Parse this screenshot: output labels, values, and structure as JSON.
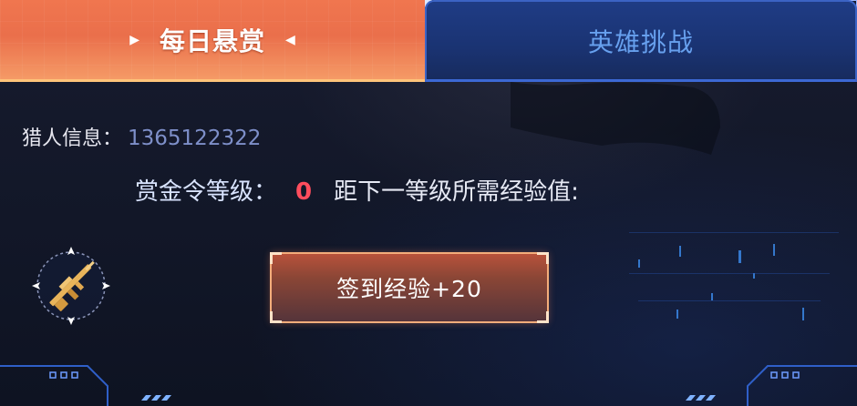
{
  "tabs": [
    {
      "label": "每日悬赏",
      "active": true
    },
    {
      "label": "英雄挑战",
      "active": false
    }
  ],
  "hunter": {
    "label": "猎人信息：",
    "value": "1365122322"
  },
  "level": {
    "label": "赏金令等级：",
    "value": "0",
    "next_label": "距下一等级所需经验值:"
  },
  "sign_button": {
    "label": "签到经验+20"
  },
  "icons": {
    "weapon": "rifle-crosshair-icon",
    "tab_arrows": "triangle-arrow-icon"
  },
  "colors": {
    "active_tab": "#ee7350",
    "inactive_tab": "#1d397c",
    "level_value": "#ff4d5d",
    "hunter_value": "#7e8fc9"
  }
}
